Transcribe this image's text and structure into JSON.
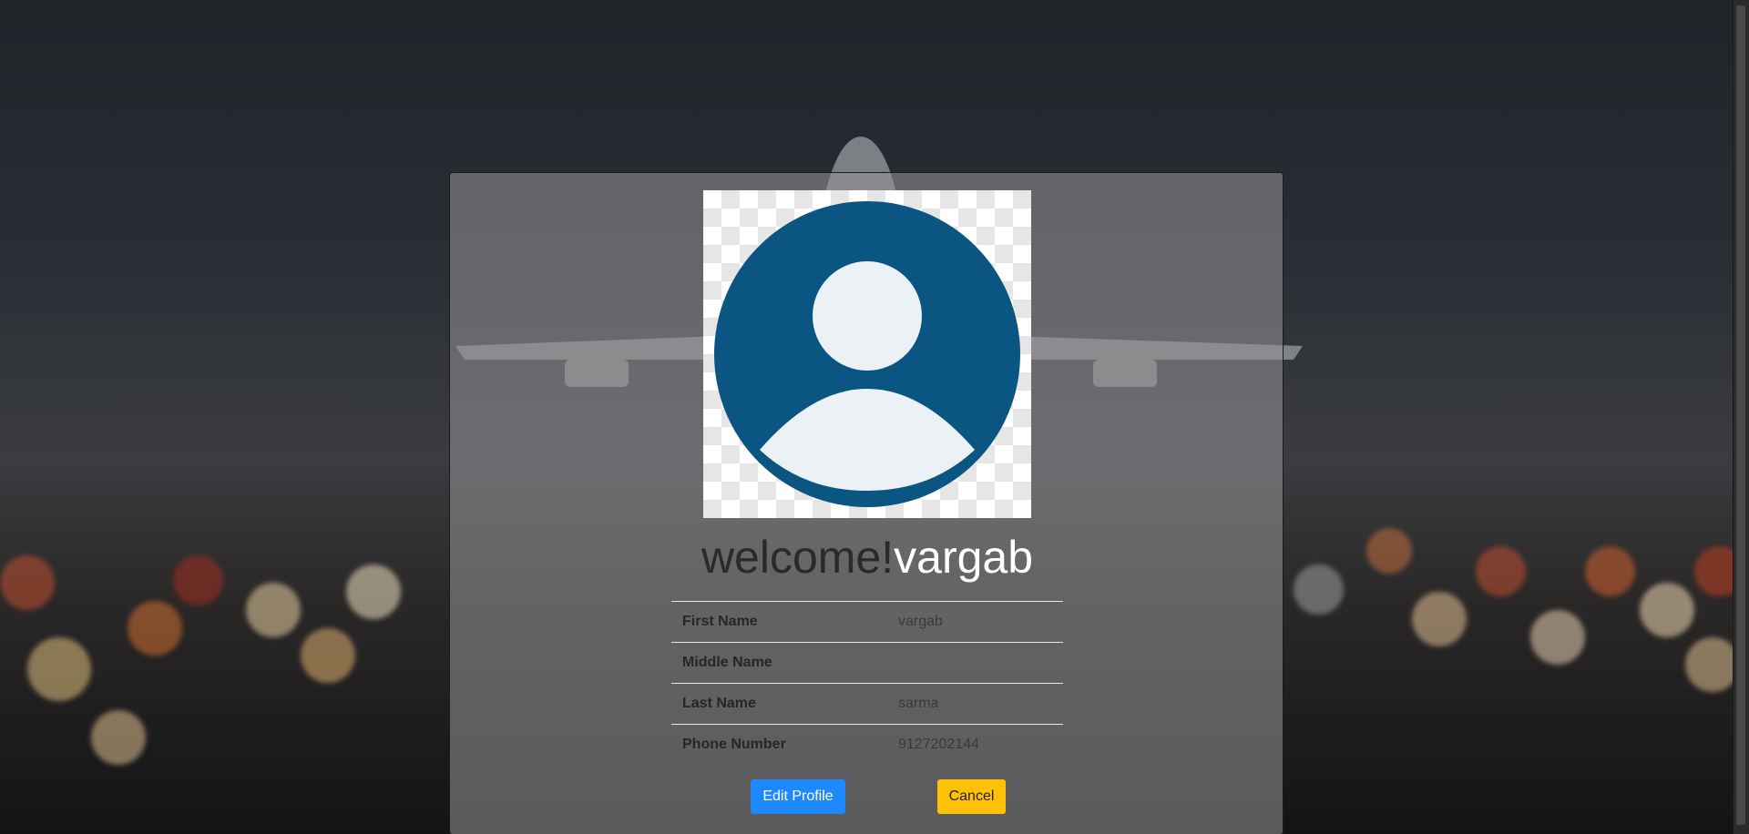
{
  "welcome": {
    "greeting": "welcome!",
    "username": "vargab"
  },
  "profile": {
    "rows": [
      {
        "label": "First Name",
        "value": "vargab"
      },
      {
        "label": "Middle Name",
        "value": ""
      },
      {
        "label": "Last Name",
        "value": "sarma"
      },
      {
        "label": "Phone Number",
        "value": "9127202144"
      }
    ]
  },
  "actions": {
    "edit_label": "Edit Profile",
    "cancel_label": "Cancel"
  },
  "colors": {
    "avatar": "#0b5583",
    "primary": "#1e88ff",
    "warning": "#ffc107"
  },
  "icons": {
    "avatar": "user-avatar-icon"
  }
}
